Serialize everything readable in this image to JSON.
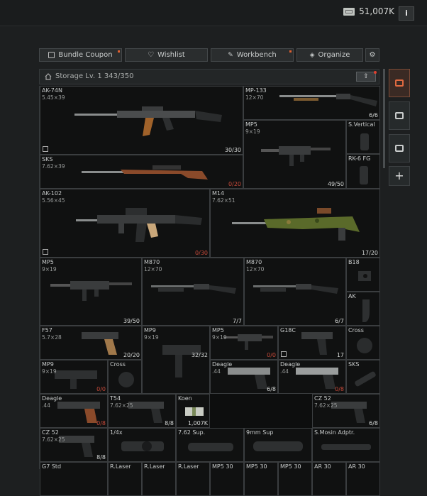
{
  "header": {
    "money": "51,007K",
    "info_label": "i"
  },
  "toolbar": [
    {
      "label": "Bundle Coupon"
    },
    {
      "label": "Wishlist"
    },
    {
      "label": "Workbench"
    },
    {
      "label": "Organize"
    }
  ],
  "storage": {
    "title": "Storage Lv. 1 343/350",
    "sort_label": "⇧"
  },
  "side": {
    "add_label": "+"
  },
  "items": {
    "ak74n": {
      "name": "AK-74N",
      "cal": "5.45×39",
      "count": "30/30"
    },
    "mp133": {
      "name": "MP-133",
      "cal": "12×70",
      "count": "6/6"
    },
    "mp5a": {
      "name": "MP5",
      "cal": "9×19",
      "count": "49/50"
    },
    "svert": {
      "name": "S.Vertical"
    },
    "rk6": {
      "name": "RK-6 FG"
    },
    "sks": {
      "name": "SKS",
      "cal": "7.62×39",
      "count": "0/20"
    },
    "ak102": {
      "name": "AK-102",
      "cal": "5.56×45",
      "count": "0/30"
    },
    "m14": {
      "name": "M14",
      "cal": "7.62×51",
      "count": "17/20"
    },
    "mp5b": {
      "name": "MP5",
      "cal": "9×19",
      "count": "39/50"
    },
    "m870a": {
      "name": "M870",
      "cal": "12×70",
      "count": "7/7"
    },
    "m870b": {
      "name": "M870",
      "cal": "12×70",
      "count": "6/7"
    },
    "b18": {
      "name": "B18"
    },
    "akmag": {
      "name": "AK"
    },
    "f57": {
      "name": "F57",
      "cal": "5.7×28",
      "count": "20/20"
    },
    "mp9a": {
      "name": "MP9",
      "cal": "9×19",
      "count": ""
    },
    "mp5c": {
      "name": "MP5",
      "cal": "9×19",
      "count": "0/0"
    },
    "g18c": {
      "name": "G18C",
      "cal": "",
      "count": "17"
    },
    "cross1": {
      "name": "Cross"
    },
    "mp9b": {
      "name": "MP9",
      "cal": "9×19",
      "count": "0/0"
    },
    "cross2": {
      "name": "Cross"
    },
    "mp9c": {
      "name": "",
      "cal": "",
      "count": "32/32"
    },
    "deagle1": {
      "name": "Deagle",
      "cal": ".44",
      "count": "6/8"
    },
    "deagle2": {
      "name": "Deagle",
      "cal": ".44",
      "count": "0/8"
    },
    "sks2": {
      "name": "SKS"
    },
    "deagle3": {
      "name": "Deagle",
      "cal": ".44",
      "count": "0/8"
    },
    "t54": {
      "name": "T54",
      "cal": "7.62×25",
      "count": "8/8"
    },
    "koen": {
      "name": "Koen",
      "count": "1,007K"
    },
    "cz52a": {
      "name": "CZ 52",
      "cal": "7.62×25",
      "count": "6/8"
    },
    "cz52b": {
      "name": "CZ 52",
      "cal": "7.62×25",
      "count": "8/8"
    },
    "scope": {
      "name": "1/4x"
    },
    "sup762": {
      "name": "7.62 Sup."
    },
    "sup9": {
      "name": "9mm Sup"
    },
    "mosin": {
      "name": "S.Mosin Adptr."
    },
    "b1": {
      "name": "G7 Std"
    },
    "b2": {
      "name": "R.Laser"
    },
    "b3": {
      "name": "R.Laser"
    },
    "b4": {
      "name": "R.Laser"
    },
    "b5": {
      "name": "MP5 30"
    },
    "b6": {
      "name": "MP5 30"
    },
    "b7": {
      "name": "MP5 30"
    },
    "b8": {
      "name": "AR 30"
    },
    "b9": {
      "name": "AR 30"
    }
  },
  "colors": {
    "accent": "#e06030",
    "count_empty": "#c84a3a",
    "grid_border": "#3a3d3f"
  }
}
